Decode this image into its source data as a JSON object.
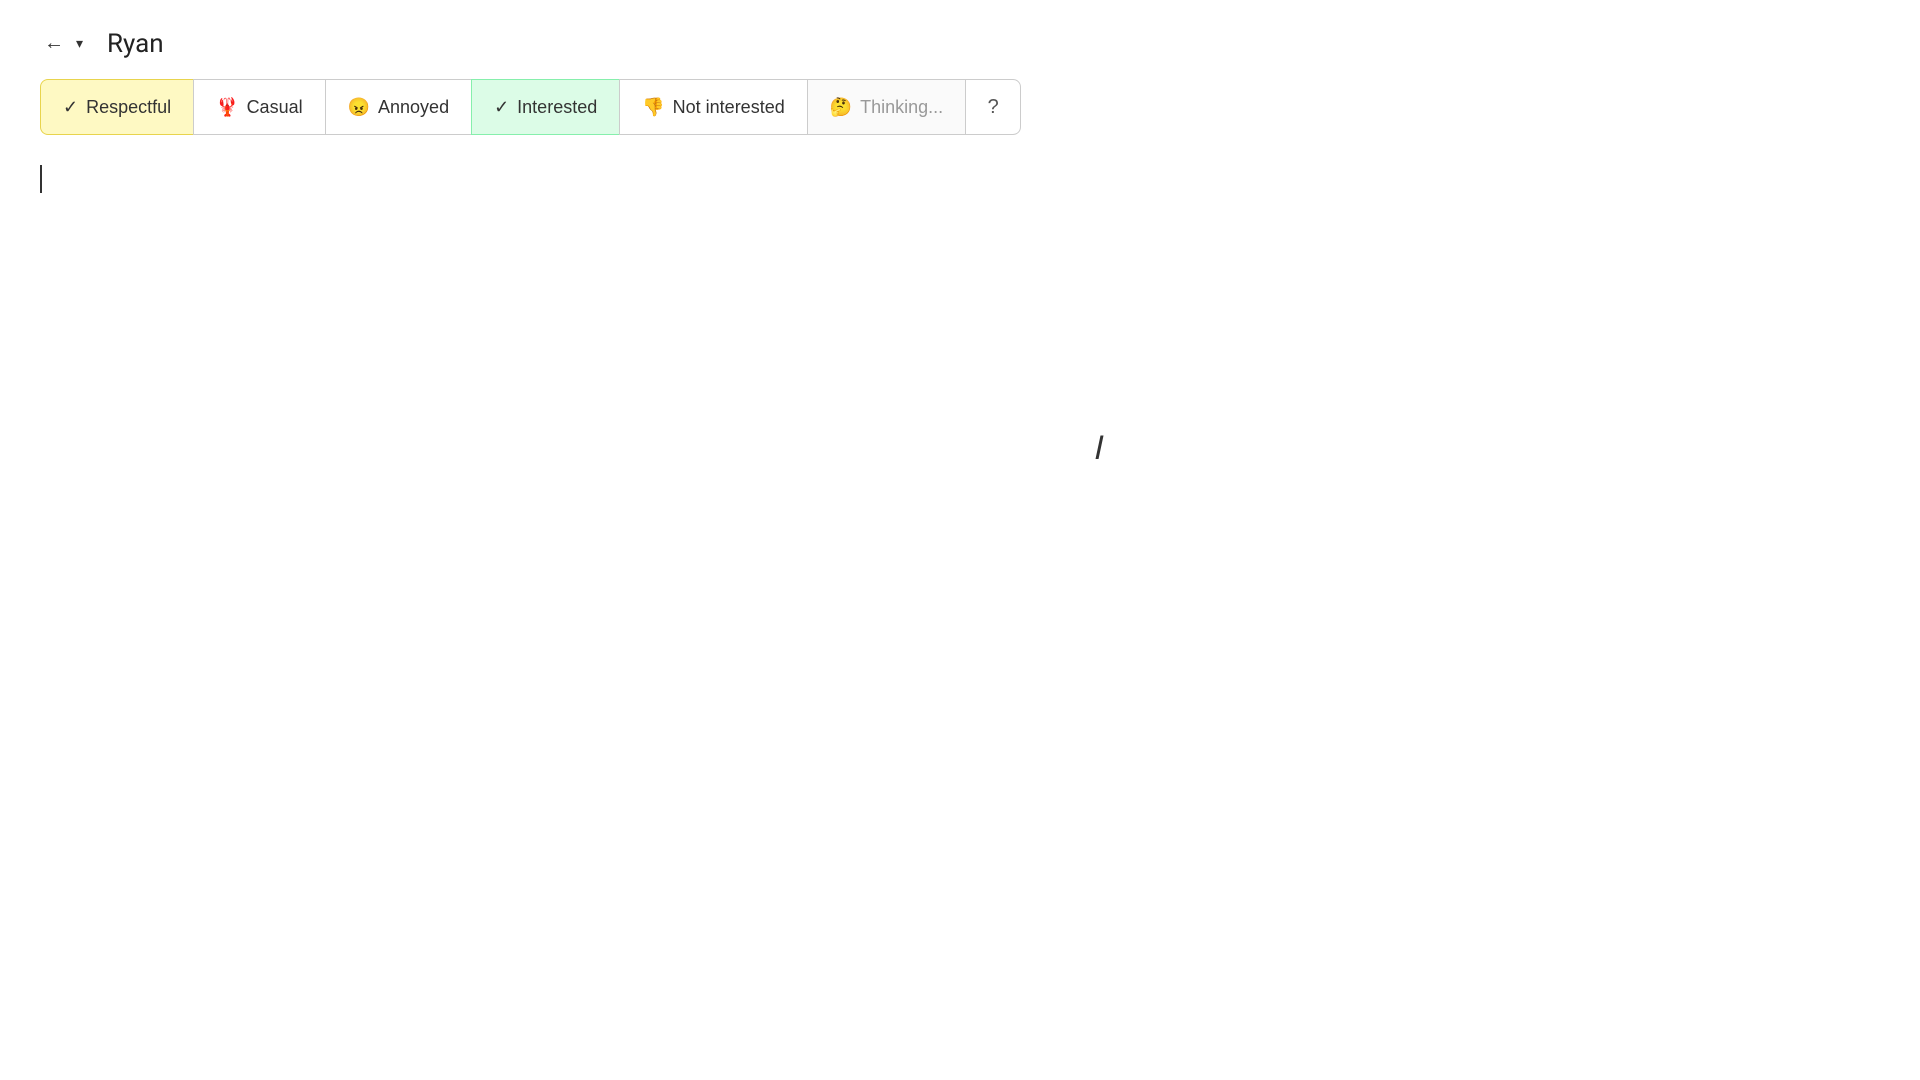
{
  "header": {
    "title": "Ryan",
    "back_label": "←",
    "dropdown_label": "▾"
  },
  "toolbar": {
    "buttons": [
      {
        "id": "respectful",
        "icon": "✓",
        "label": "Respectful",
        "active": true,
        "style": "active-yellow"
      },
      {
        "id": "casual",
        "icon": "🦞",
        "label": "Casual",
        "active": false,
        "style": ""
      },
      {
        "id": "annoyed",
        "icon": "😠",
        "label": "Annoyed",
        "active": false,
        "style": ""
      },
      {
        "id": "interested",
        "icon": "✓",
        "label": "Interested",
        "active": true,
        "style": "active-green"
      },
      {
        "id": "not-interested",
        "icon": "👎",
        "label": "Not interested",
        "active": false,
        "style": "not-interested"
      },
      {
        "id": "thinking",
        "icon": "🤔",
        "label": "Thinking...",
        "active": false,
        "style": "thinking"
      }
    ],
    "question_label": "?"
  }
}
